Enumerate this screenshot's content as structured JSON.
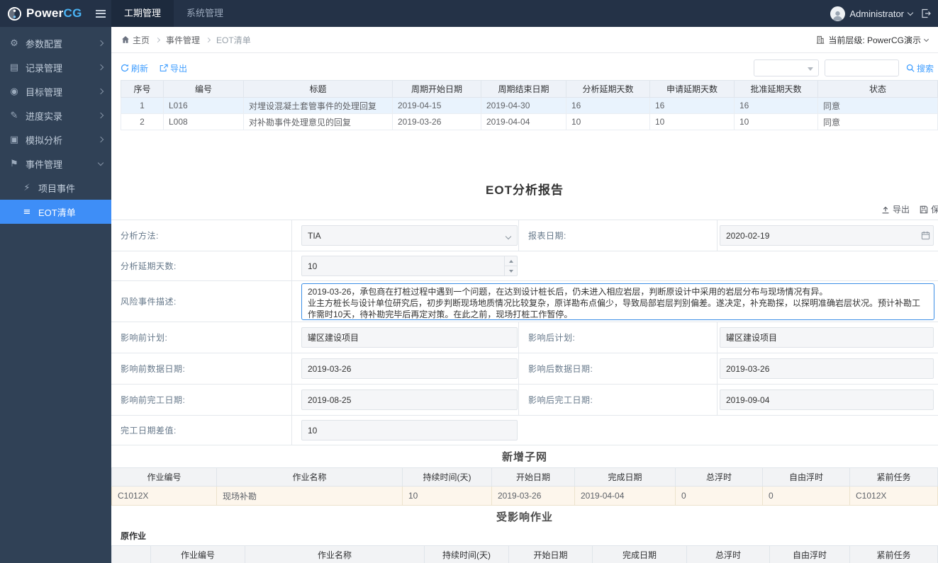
{
  "colors": {
    "accent": "#409eff",
    "navbar_bg": "#243247",
    "sidebar_bg": "#304156",
    "sidebar_active_bg": "#3e8ef7",
    "selected_row_bg": "#e9f3fd",
    "new_activity_row_bg": "#fdf6ec",
    "logo_cg_color": "#4ab3f4"
  },
  "navbar": {
    "logo_power": "Power",
    "logo_cg": "CG",
    "menu": [
      {
        "label": "工期管理"
      },
      {
        "label": "系统管理"
      }
    ],
    "user_name": "Administrator"
  },
  "sidebar": {
    "items": [
      {
        "label": "参数配置",
        "icon": "gear-icon",
        "glyph": "⚙"
      },
      {
        "label": "记录管理",
        "icon": "records-icon",
        "glyph": "▤"
      },
      {
        "label": "目标管理",
        "icon": "target-icon",
        "glyph": "◉"
      },
      {
        "label": "进度实录",
        "icon": "progress-icon",
        "glyph": "✎"
      },
      {
        "label": "模拟分析",
        "icon": "simulation-icon",
        "glyph": "▣"
      },
      {
        "label": "事件管理",
        "icon": "flag-icon",
        "glyph": "⚑"
      }
    ],
    "subitems": [
      {
        "label": "项目事件",
        "icon": "bolt-icon",
        "glyph": "⚡"
      },
      {
        "label": "EOT清单",
        "icon": "list-icon",
        "glyph": "≡"
      }
    ]
  },
  "breadcrumb": {
    "items": [
      "主页",
      "事件管理",
      "EOT清单"
    ],
    "current_level": "当前层级: PowerCG演示"
  },
  "toolbar": {
    "refresh_label": "刷新",
    "export_label": "导出",
    "search_label": "搜索",
    "filter_value": "",
    "search_value": ""
  },
  "eot": {
    "headers": [
      "序号",
      "编号",
      "标题",
      "周期开始日期",
      "周期结束日期",
      "分析延期天数",
      "申请延期天数",
      "批准延期天数",
      "状态"
    ],
    "rows": [
      [
        "1",
        "L016",
        "对埋设混凝土套管事件的处理回复",
        "2019-04-15",
        "2019-04-30",
        "16",
        "16",
        "16",
        "同意"
      ],
      [
        "2",
        "L008",
        "对补勘事件处理意见的回复",
        "2019-03-26",
        "2019-04-04",
        "10",
        "10",
        "10",
        "同意"
      ]
    ]
  },
  "report": {
    "title": "EOT分析报告",
    "export_label": "导出",
    "save_label": "保存",
    "fields": {
      "analysis_method": {
        "label": "分析方法:",
        "value": "TIA"
      },
      "report_date": {
        "label": "报表日期:",
        "value": "2020-02-19"
      },
      "analysis_delay_days": {
        "label": "分析延期天数:",
        "value": "10"
      },
      "risk_description": {
        "label": "风险事件描述:",
        "value": "2019-03-26，承包商在打桩过程中遇到一个问题，在达到设计桩长后，仍未进入相应岩层，判断原设计中采用的岩层分布与现场情况有异。\n业主方桩长与设计单位研究后，初步判断现场地质情况比较复杂，原详勘布点偏少，导致局部岩层判别偏差。遂决定，补充勘探，以探明准确岩层状况。预计补勘工作需时10天，待补勘完毕后再定对策。在此之前，现场打桩工作暂停。"
      },
      "pre_plan": {
        "label": "影响前计划:",
        "value": "罐区建设项目"
      },
      "post_plan": {
        "label": "影响后计划:",
        "value": "罐区建设项目"
      },
      "pre_data_date": {
        "label": "影响前数据日期:",
        "value": "2019-03-26"
      },
      "post_data_date": {
        "label": "影响后数据日期:",
        "value": "2019-03-26"
      },
      "pre_finish_date": {
        "label": "影响前完工日期:",
        "value": "2019-08-25"
      },
      "post_finish_date": {
        "label": "影响后完工日期:",
        "value": "2019-09-04"
      },
      "finish_date_diff": {
        "label": "完工日期差值:",
        "value": "10"
      }
    }
  },
  "subnet": {
    "title": "新增子网",
    "headers": [
      "作业编号",
      "作业名称",
      "持续时间(天)",
      "开始日期",
      "完成日期",
      "总浮时",
      "自由浮时",
      "紧前任务"
    ],
    "rows": [
      [
        "C1012X",
        "现场补勘",
        "10",
        "2019-03-26",
        "2019-04-04",
        "0",
        "0",
        "C1012X"
      ]
    ]
  },
  "affected": {
    "title": "受影响作业",
    "group_label": "原作业",
    "headers": [
      "",
      "作业编号",
      "作业名称",
      "持续时间(天)",
      "开始日期",
      "完成日期",
      "总浮时",
      "自由浮时",
      "紧前任务"
    ],
    "rows": []
  }
}
